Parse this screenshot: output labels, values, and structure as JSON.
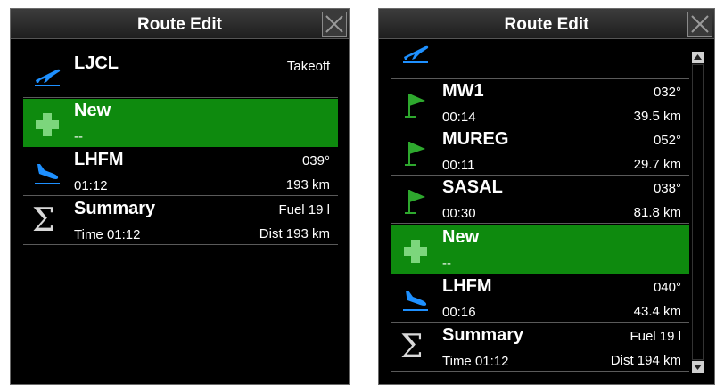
{
  "left": {
    "title": "Route Edit",
    "rows": [
      {
        "name": "LJCL",
        "right1": "Takeoff",
        "icon": "takeoff-icon"
      },
      {
        "name": "New",
        "sub": "--",
        "icon": "add-icon"
      },
      {
        "name": "LHFM",
        "sub": "01:12",
        "right1": "039°",
        "right2": "193 km",
        "icon": "landing-icon"
      },
      {
        "name": "Summary",
        "sub": "Time 01:12",
        "right1": "Fuel 19 l",
        "right2": "Dist 193 km",
        "icon": "sigma-icon"
      }
    ]
  },
  "right": {
    "title": "Route Edit",
    "rows": [
      {
        "name": "MW1",
        "sub": "00:14",
        "right1": "032°",
        "right2": "39.5 km",
        "icon": "flag-icon"
      },
      {
        "name": "MUREG",
        "sub": "00:11",
        "right1": "052°",
        "right2": "29.7 km",
        "icon": "flag-icon"
      },
      {
        "name": "SASAL",
        "sub": "00:30",
        "right1": "038°",
        "right2": "81.8 km",
        "icon": "flag-icon"
      },
      {
        "name": "New",
        "sub": "--",
        "icon": "add-icon"
      },
      {
        "name": "LHFM",
        "sub": "00:16",
        "right1": "040°",
        "right2": "43.4 km",
        "icon": "landing-icon"
      },
      {
        "name": "Summary",
        "sub": "Time 01:12",
        "right1": "Fuel 19 l",
        "right2": "Dist 194 km",
        "icon": "sigma-icon"
      }
    ]
  },
  "colors": {
    "new_row": "#0e8a0e",
    "plane": "#1e90ff",
    "flag": "#2ea82e"
  }
}
